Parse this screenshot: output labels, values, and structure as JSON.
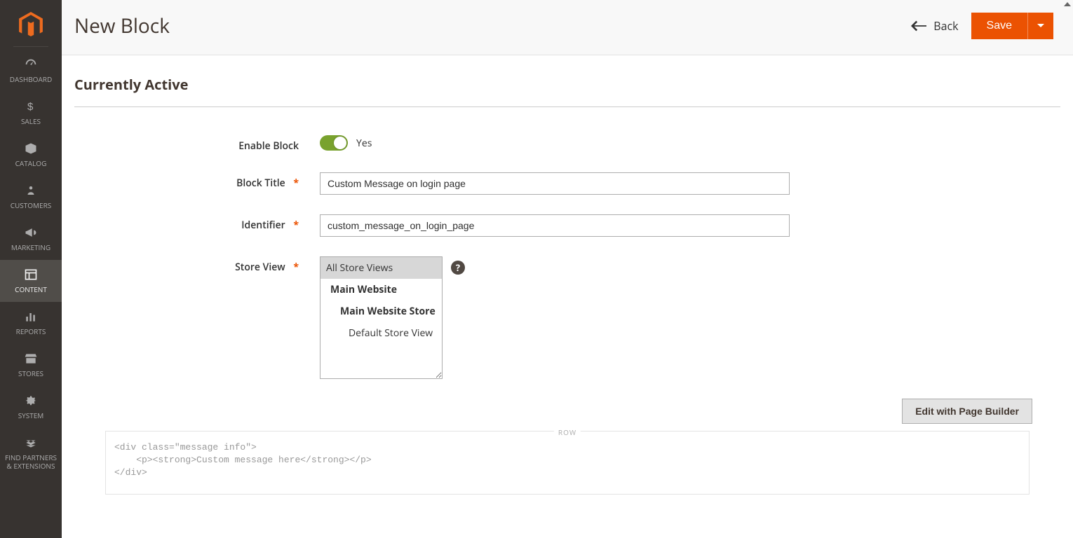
{
  "sidebar": {
    "items": [
      {
        "label": "DASHBOARD",
        "icon": "dashboard-icon"
      },
      {
        "label": "SALES",
        "icon": "dollar-icon"
      },
      {
        "label": "CATALOG",
        "icon": "box-icon"
      },
      {
        "label": "CUSTOMERS",
        "icon": "person-icon"
      },
      {
        "label": "MARKETING",
        "icon": "megaphone-icon"
      },
      {
        "label": "CONTENT",
        "icon": "layout-icon"
      },
      {
        "label": "REPORTS",
        "icon": "bars-icon"
      },
      {
        "label": "STORES",
        "icon": "storefront-icon"
      },
      {
        "label": "SYSTEM",
        "icon": "gear-icon"
      },
      {
        "label": "FIND PARTNERS & EXTENSIONS",
        "icon": "blocks-icon"
      }
    ],
    "active_index": 5
  },
  "header": {
    "title": "New Block",
    "back_label": "Back",
    "save_label": "Save"
  },
  "section": {
    "title": "Currently Active"
  },
  "form": {
    "enable_block": {
      "label": "Enable Block",
      "value_text": "Yes",
      "checked": true
    },
    "block_title": {
      "label": "Block Title",
      "value": "Custom Message on login page"
    },
    "identifier": {
      "label": "Identifier",
      "value": "custom_message_on_login_page"
    },
    "store_view": {
      "label": "Store View",
      "options": [
        {
          "text": "All Store Views",
          "level": "root",
          "selected": true
        },
        {
          "text": "Main Website",
          "level": "group"
        },
        {
          "text": "Main Website Store",
          "level": "subgroup"
        },
        {
          "text": "Default Store View",
          "level": "leaf"
        }
      ]
    }
  },
  "editor": {
    "pb_button": "Edit with Page Builder",
    "row_tag": "ROW",
    "content_lines": [
      "<div class=\"message info\">",
      "    <p><strong>Custom message here</strong></p>",
      "</div>"
    ]
  }
}
